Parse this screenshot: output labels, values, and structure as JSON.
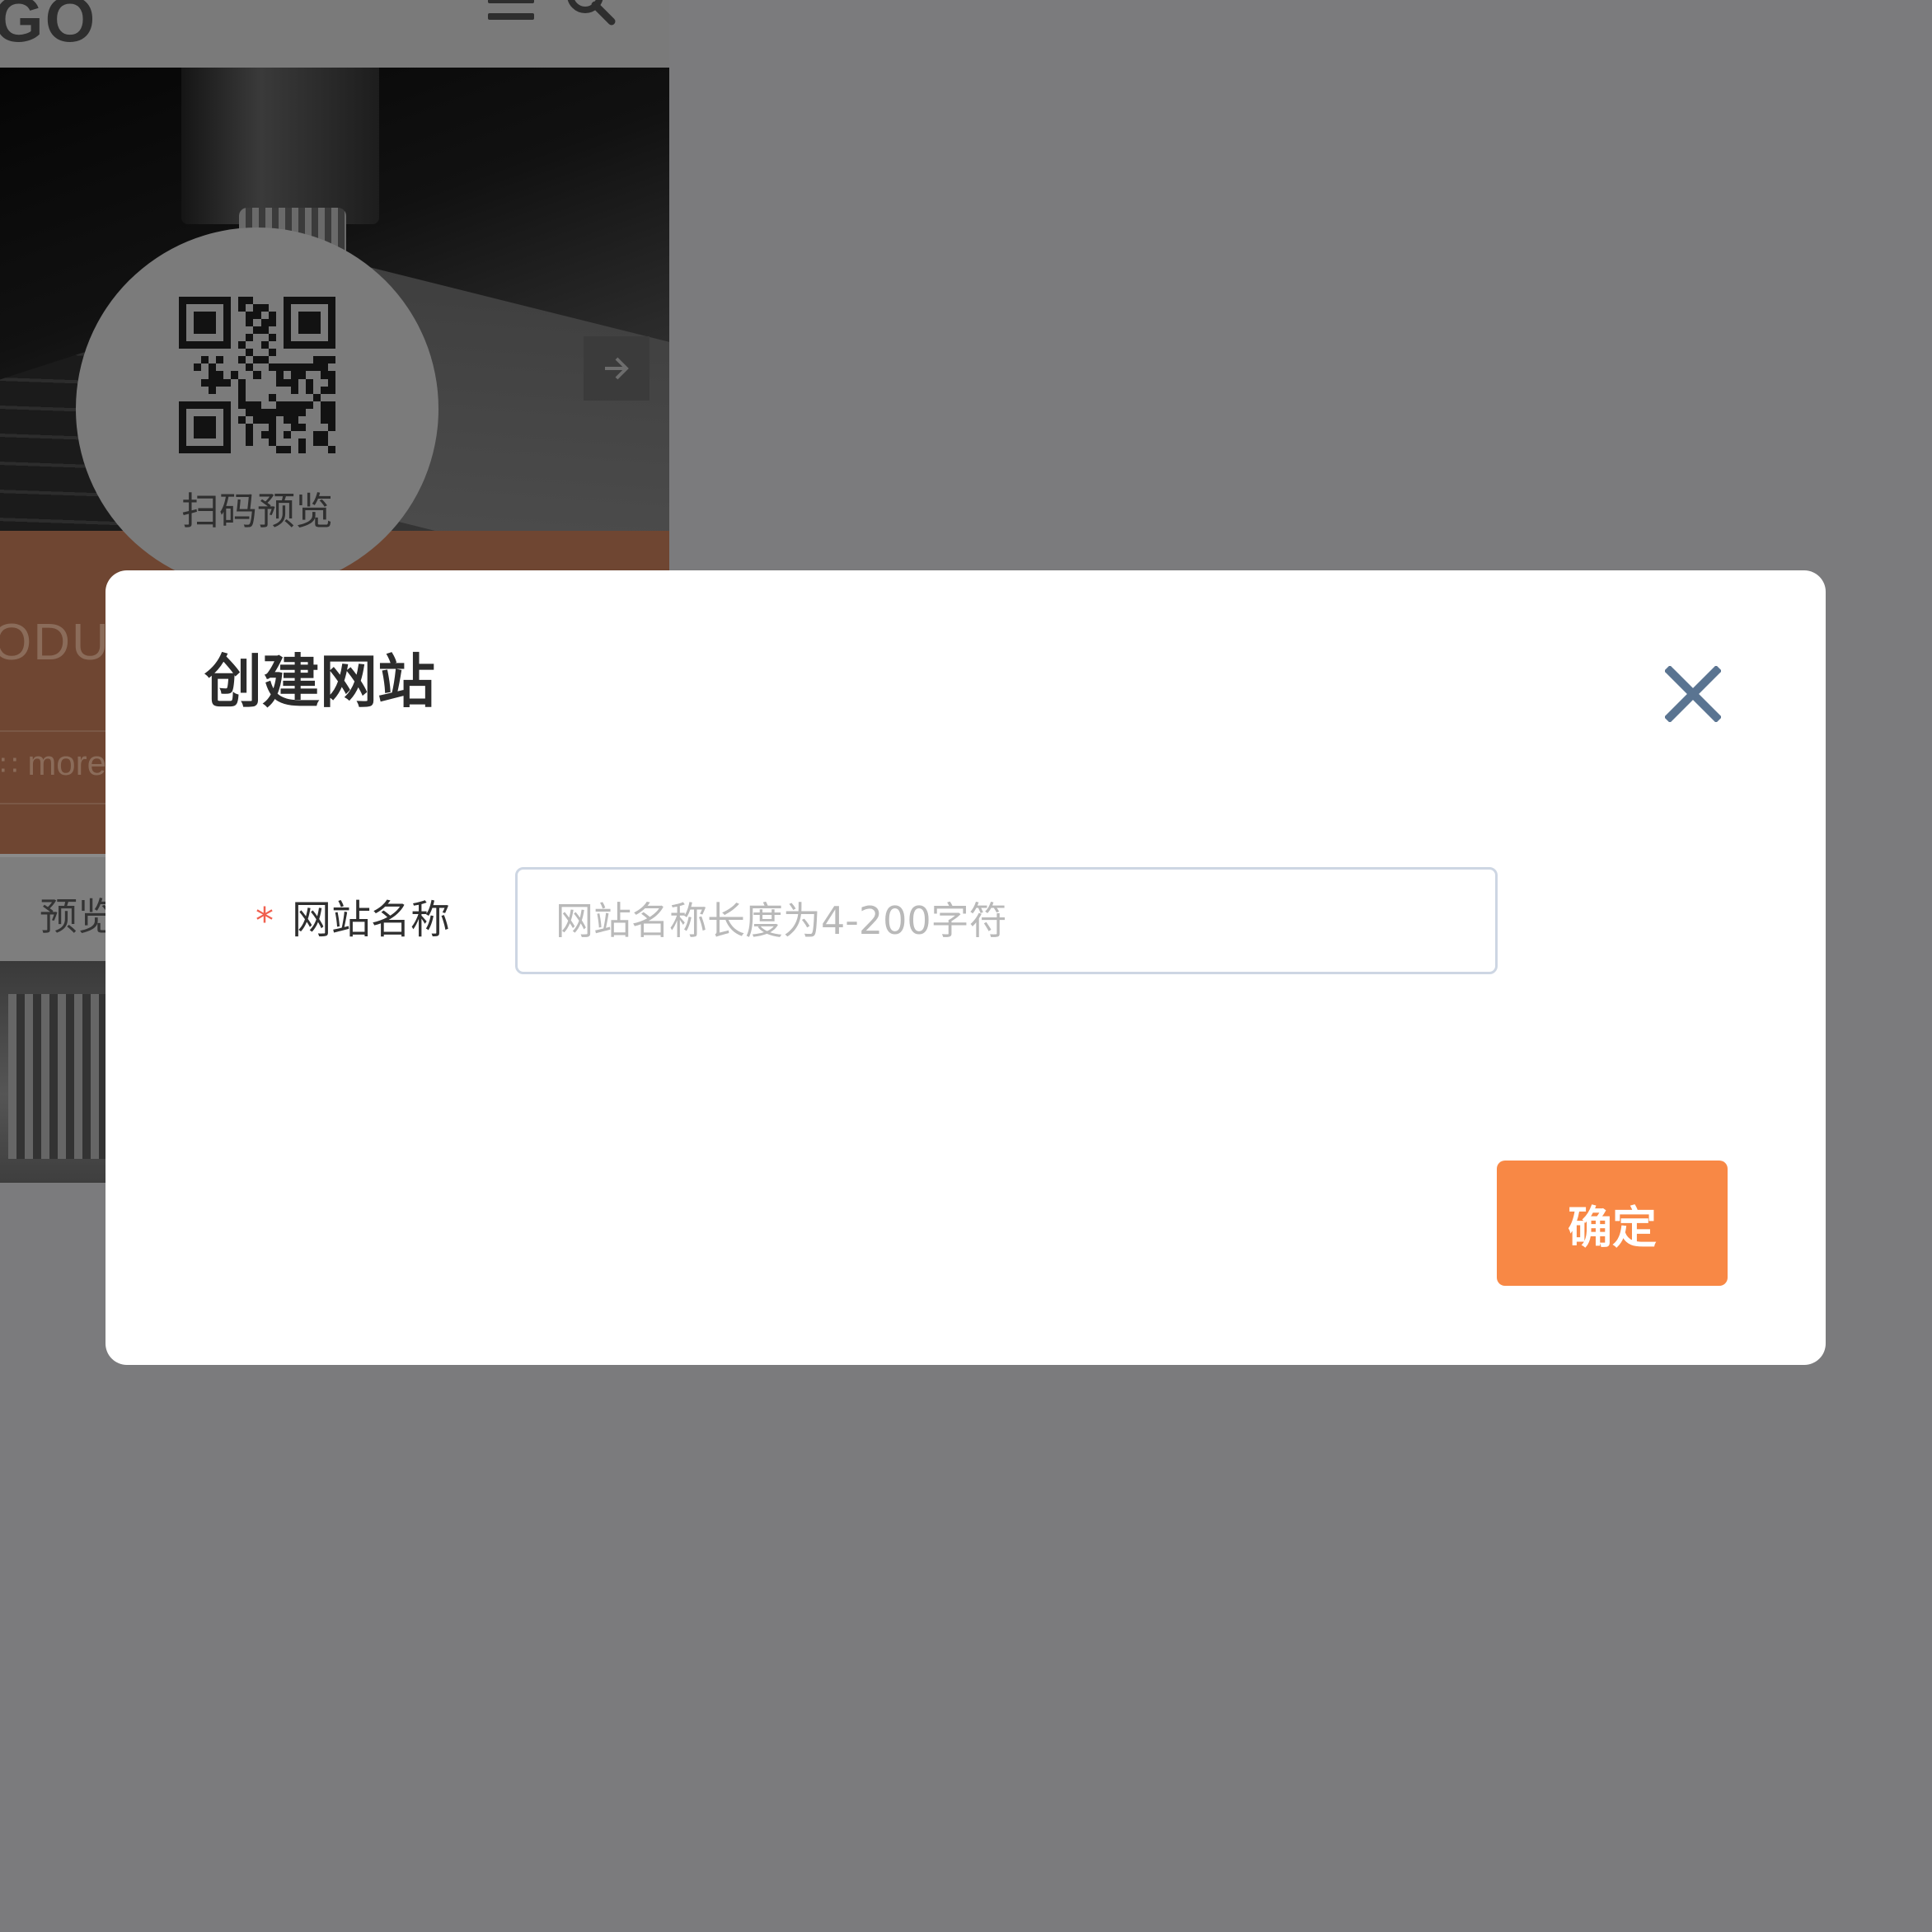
{
  "background_preview": {
    "logo_text": "GO",
    "menu_icon": "hamburger-menu-icon",
    "search_icon": "search-icon",
    "hero_next_icon": "arrow-right-icon",
    "section_title": "ODU",
    "more_text": "more",
    "preview_tab_label": "预览",
    "qr_icon": "qr-code-icon",
    "qr_caption": "扫码预览"
  },
  "modal": {
    "title": "创建网站",
    "close_icon": "close-icon",
    "close_color": "#5a7491",
    "form": {
      "required_mark": "*",
      "label": "网站名称",
      "input_value": "",
      "input_placeholder": "网站名称长度为4-200字符"
    },
    "confirm_label": "确定",
    "accent_color": "#f88845"
  }
}
